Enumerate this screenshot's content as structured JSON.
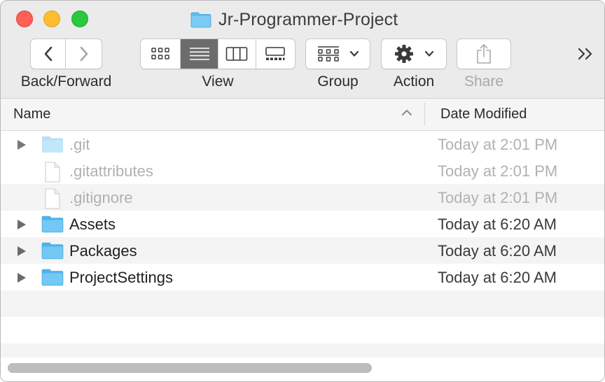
{
  "window": {
    "title": "Jr-Programmer-Project"
  },
  "toolbar": {
    "nav_label": "Back/Forward",
    "view_label": "View",
    "group_label": "Group",
    "action_label": "Action",
    "share_label": "Share",
    "view_modes": [
      "icon",
      "list",
      "column",
      "gallery"
    ],
    "active_view": "list"
  },
  "columns": {
    "name": "Name",
    "date_modified": "Date Modified"
  },
  "files": [
    {
      "name": ".git",
      "date": "Today at 2:01 PM",
      "kind": "folder",
      "expandable": true,
      "hidden": true
    },
    {
      "name": ".gitattributes",
      "date": "Today at 2:01 PM",
      "kind": "file",
      "expandable": false,
      "hidden": true
    },
    {
      "name": ".gitignore",
      "date": "Today at 2:01 PM",
      "kind": "file",
      "expandable": false,
      "hidden": true
    },
    {
      "name": "Assets",
      "date": "Today at 6:20 AM",
      "kind": "folder",
      "expandable": true,
      "hidden": false
    },
    {
      "name": "Packages",
      "date": "Today at 6:20 AM",
      "kind": "folder",
      "expandable": true,
      "hidden": false
    },
    {
      "name": "ProjectSettings",
      "date": "Today at 6:20 AM",
      "kind": "folder",
      "expandable": true,
      "hidden": false
    }
  ],
  "colors": {
    "folder": "#5ebdf0",
    "close": "#fe5f57",
    "minimize": "#febc2e",
    "zoom": "#28c840",
    "active_segment": "#6c6c6c"
  }
}
